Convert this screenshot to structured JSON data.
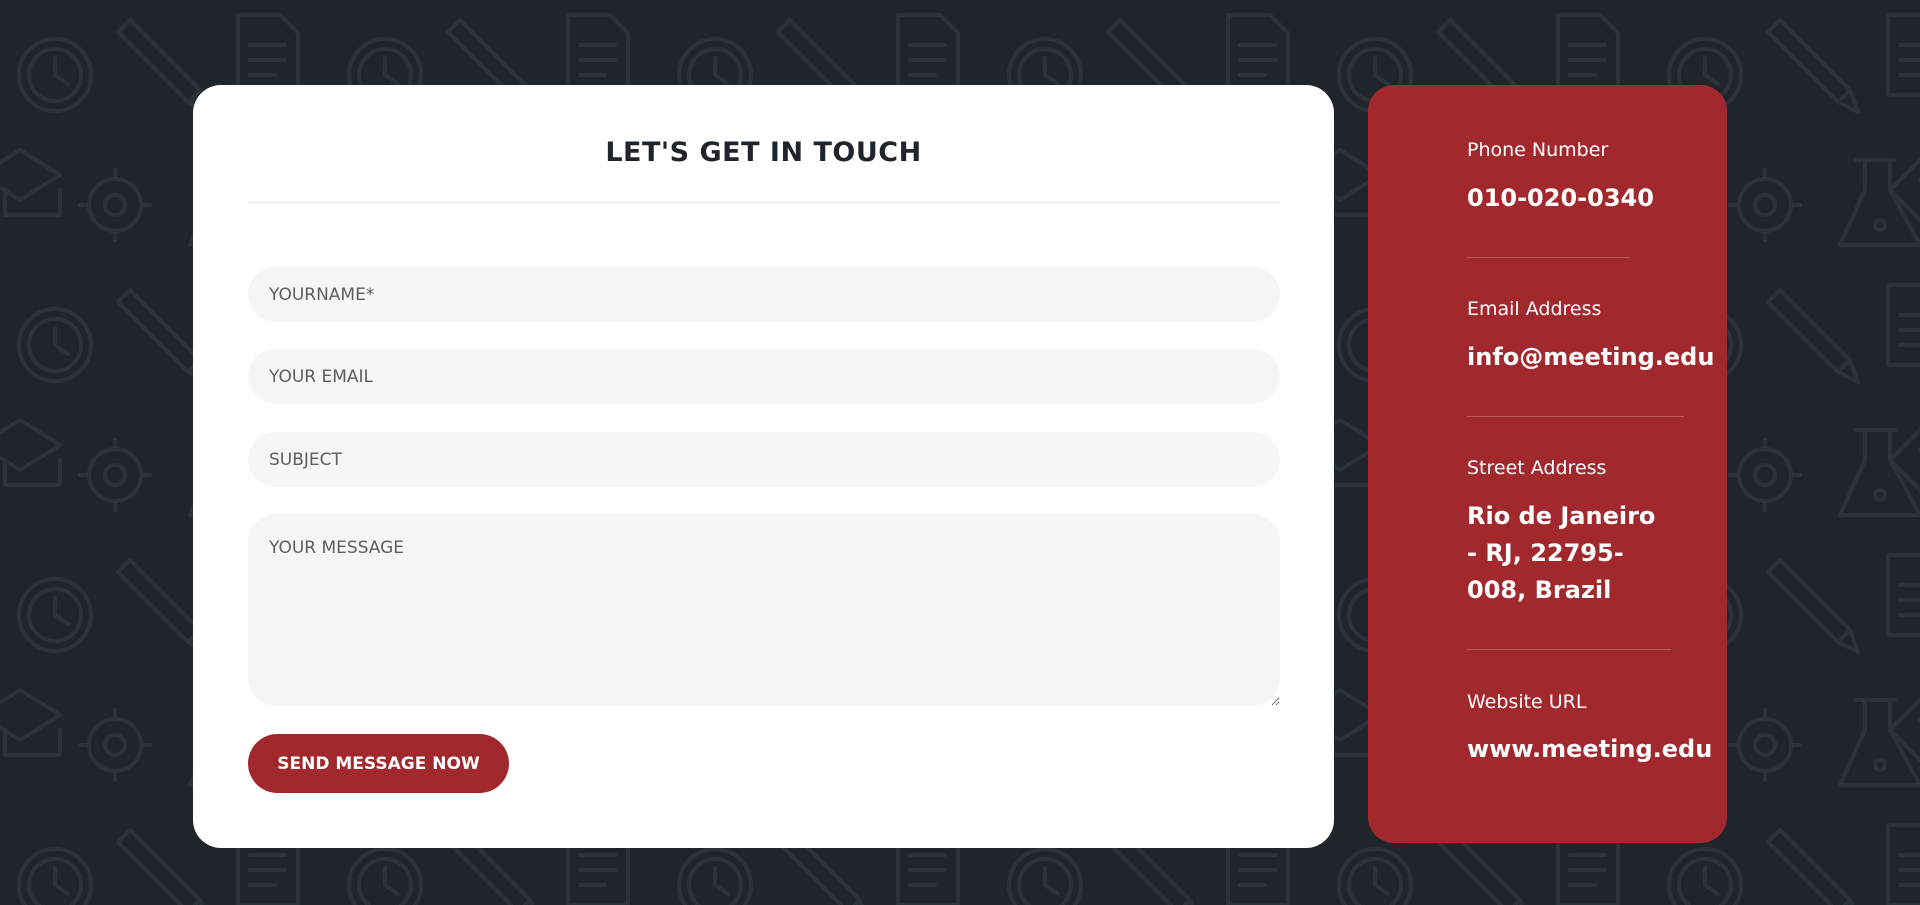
{
  "colors": {
    "background": "#1f252b",
    "accent": "#a1282d",
    "card": "#ffffff",
    "field": "#f6f6f6"
  },
  "contact_form": {
    "title": "LET'S GET IN TOUCH",
    "fields": {
      "name": {
        "value": "",
        "placeholder": "YOURNAME*"
      },
      "email": {
        "value": "",
        "placeholder": "YOUR EMAIL"
      },
      "subject": {
        "value": "",
        "placeholder": "SUBJECT"
      },
      "message": {
        "value": "",
        "placeholder": "YOUR MESSAGE"
      }
    },
    "submit_label": "SEND MESSAGE NOW"
  },
  "contact_info": {
    "phone": {
      "label": "Phone Number",
      "value": "010-020-0340"
    },
    "email": {
      "label": "Email Address",
      "value": "info@meeting.edu"
    },
    "address": {
      "label": "Street Address",
      "value": "Rio de Janeiro - RJ, 22795-008, Brazil"
    },
    "website": {
      "label": "Website URL",
      "value": "www.meeting.edu"
    }
  },
  "background_pattern_icons": [
    "clock-icon",
    "pencil-icon",
    "document-icon",
    "gear-icon",
    "flask-icon",
    "graduation-cap-icon",
    "book-icon",
    "ruler-icon",
    "microscope-icon"
  ]
}
